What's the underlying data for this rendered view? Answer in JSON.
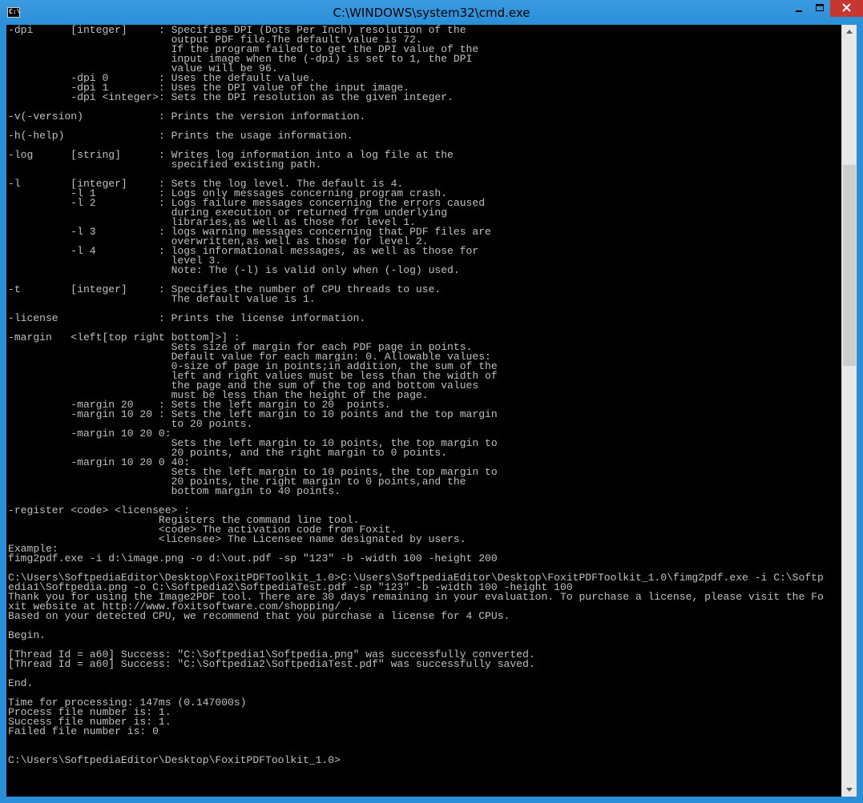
{
  "window": {
    "title": "C:\\WINDOWS\\system32\\cmd.exe",
    "icon_text": "C:\\"
  },
  "controls": {
    "minimize_icon": "minimize-icon",
    "maximize_icon": "maximize-icon",
    "close_icon": "close-icon"
  },
  "console": {
    "text": "-dpi      [integer]     : Specifies DPI (Dots Per Inch) resolution of the\n                          output PDF file.The default value is 72.\n                          If the program failed to get the DPI value of the\n                          input image when the (-dpi) is set to 1, the DPI\n                          value will be 96.\n          -dpi 0        : Uses the default value.\n          -dpi 1        : Uses the DPI value of the input image.\n          -dpi <integer>: Sets the DPI resolution as the given integer.\n\n-v(-version)            : Prints the version information.\n\n-h(-help)               : Prints the usage information.\n\n-log      [string]      : Writes log information into a log file at the\n                          specified existing path.\n\n-l        [integer]     : Sets the log level. The default is 4.\n          -l 1          : Logs only messages concerning program crash.\n          -l 2          : Logs failure messages concerning the errors caused\n                          during execution or returned from underlying\n                          libraries,as well as those for level 1.\n          -l 3          : logs warning messages concerning that PDF files are\n                          overwritten,as well as those for level 2.\n          -l 4          : logs informational messages, as well as those for\n                          level 3.\n                          Note: The (-l) is valid only when (-log) used.\n\n-t        [integer]     : Specifies the number of CPU threads to use.\n                          The default value is 1.\n\n-license                : Prints the license information.\n\n-margin   <left[top right bottom]>] :\n                          Sets size of margin for each PDF page in points.\n                          Default value for each margin: 0. Allowable values:\n                          0-size of page in points;in addition, the sum of the\n                          left and right values must be less than the width of\n                          the page and the sum of the top and bottom values\n                          must be less than the height of the page.\n          -margin 20    : Sets the left margin to 20  points.\n          -margin 10 20 : Sets the left margin to 10 points and the top margin\n                          to 20 points.\n          -margin 10 20 0:\n                          Sets the left margin to 10 points, the top margin to\n                          20 points, and the right margin to 0 points.\n          -margin 10 20 0 40:\n                          Sets the left margin to 10 points, the top margin to\n                          20 points, the right margin to 0 points,and the\n                          bottom margin to 40 points.\n\n-register <code> <licensee> :\n                        Registers the command line tool.\n                        <code> The activation code from Foxit.\n                        <licensee> The Licensee name designated by users.\nExample:\nfimg2pdf.exe -i d:\\image.png -o d:\\out.pdf -sp \"123\" -b -width 100 -height 200\n\nC:\\Users\\SoftpediaEditor\\Desktop\\FoxitPDFToolkit_1.0>C:\\Users\\SoftpediaEditor\\Desktop\\FoxitPDFToolkit_1.0\\fimg2pdf.exe -i C:\\Softp\nedia1\\Softpedia.png -o C:\\Softpedia2\\SoftpediaTest.pdf -sp \"123\" -b -width 100 -height 100\nThank you for using the Image2PDF tool. There are 30 days remaining in your evaluation. To purchase a license, please visit the Fo\nxit website at http://www.foxitsoftware.com/shopping/ .\nBased on your detected CPU, we recommend that you purchase a license for 4 CPUs.\n\nBegin.\n\n[Thread Id = a60] Success: \"C:\\Softpedia1\\Softpedia.png\" was successfully converted.\n[Thread Id = a60] Success: \"C:\\Softpedia2\\SoftpediaTest.pdf\" was successfully saved.\n\nEnd.\n\nTime for processing: 147ms (0.147000s)\nProcess file number is: 1.\nSuccess file number is: 1.\nFailed file number is: 0\n\n\nC:\\Users\\SoftpediaEditor\\Desktop\\FoxitPDFToolkit_1.0>"
  },
  "scrollbar": {
    "up_icon": "scroll-up-arrow-icon",
    "down_icon": "scroll-down-arrow-icon",
    "thumb_position": 0.17,
    "thumb_size": 0.27
  },
  "colors": {
    "titlebar": "#2a8fd8",
    "close_button": "#c7372f",
    "console_bg": "#000000",
    "console_fg": "#c0c0c0"
  }
}
